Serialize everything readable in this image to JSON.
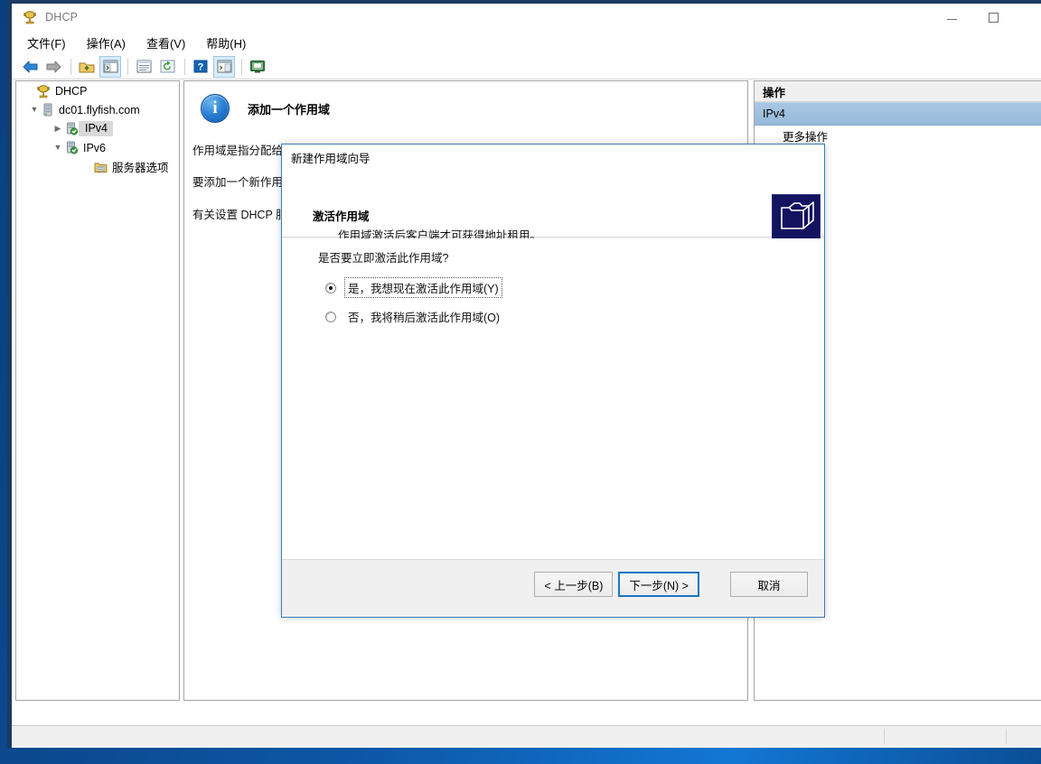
{
  "window": {
    "title": "DHCP",
    "title_icon": "dhcp-console-icon",
    "buttons": {
      "minimize": "minimize-icon",
      "maximize": "maximize-icon"
    }
  },
  "menubar": {
    "items": [
      {
        "label": "文件(F)",
        "name": "menu-file"
      },
      {
        "label": "操作(A)",
        "name": "menu-action"
      },
      {
        "label": "查看(V)",
        "name": "menu-view"
      },
      {
        "label": "帮助(H)",
        "name": "menu-help"
      }
    ]
  },
  "toolbar": {
    "items": [
      {
        "name": "back-icon",
        "glyph": "←",
        "color": "#2f7fd1",
        "active": false
      },
      {
        "name": "forward-icon",
        "glyph": "→",
        "color": "#9a9a9a",
        "active": false
      },
      {
        "name": "up-folder-icon",
        "glyph": "",
        "active": false
      },
      {
        "name": "show-tree-icon",
        "glyph": "",
        "active": true
      },
      {
        "name": "properties-icon",
        "glyph": "",
        "active": false
      },
      {
        "name": "refresh-icon",
        "glyph": "",
        "active": false
      },
      {
        "name": "help-icon",
        "glyph": "?",
        "active": false
      },
      {
        "name": "show-action-pane-icon",
        "glyph": "",
        "active": true
      },
      {
        "name": "export-list-icon",
        "glyph": "",
        "active": false
      }
    ]
  },
  "tree": {
    "nodes": [
      {
        "label": "DHCP",
        "icon": "dhcp-root-icon",
        "indent": 0,
        "twisty": "",
        "selected": false
      },
      {
        "label": "dc01.flyfish.com",
        "icon": "server-icon",
        "indent": 1,
        "twisty": "⌄",
        "selected": false
      },
      {
        "label": "IPv4",
        "icon": "protocol-icon",
        "indent": 2,
        "twisty": "›",
        "selected": true
      },
      {
        "label": "IPv6",
        "icon": "protocol-icon",
        "indent": 2,
        "twisty": "⌄",
        "selected": false
      },
      {
        "label": "服务器选项",
        "icon": "folder-options-icon",
        "indent": 3,
        "twisty": "",
        "selected": false
      }
    ]
  },
  "main": {
    "icon": "info-icon",
    "title": "添加一个作用域",
    "paragraphs": [
      "作用域是指分配给网络上计算机的 IP 地址。",
      "要添加一个新作用域，请在\"操作\"菜单上，单击\"新建作用域\"。",
      "有关设置 DHCP 服务器的详细信息，请参阅联机帮助。"
    ]
  },
  "actions": {
    "header": "操作",
    "selected_item": "IPv4",
    "items": [
      {
        "label": "更多操作",
        "name": "action-more-actions"
      }
    ]
  },
  "statusbar": {
    "text": ""
  },
  "wizard": {
    "title": "新建作用域向导",
    "header_title": "激活作用域",
    "header_subtitle": "作用域激活后客户端才可获得地址租用。",
    "header_icon": "folders-stack-icon",
    "question": "是否要立即激活此作用域?",
    "options": [
      {
        "label": "是，我想现在激活此作用域(Y)",
        "accel": "Y",
        "checked": true,
        "focused": true,
        "name": "radio-activate-now"
      },
      {
        "label": "否，我将稍后激活此作用域(O)",
        "accel": "O",
        "checked": false,
        "focused": false,
        "name": "radio-activate-later"
      }
    ],
    "buttons": {
      "back": "< 上一步(B)",
      "next": "下一步(N) >",
      "cancel": "取消"
    },
    "accent_color": "#1a76c4"
  }
}
